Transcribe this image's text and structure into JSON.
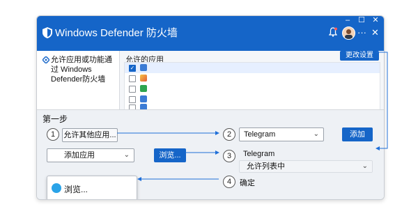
{
  "window": {
    "title": "Windows Defender 防火墙",
    "controls": {
      "minimize": "–",
      "maximize": "☐",
      "close": "✕"
    },
    "toolbar": {
      "more": "···",
      "close": "✕"
    }
  },
  "sidebar": {
    "items": [
      {
        "label": "允许应用或功能通过 Windows Defender防火墙",
        "icon": "shield-icon"
      }
    ]
  },
  "main": {
    "allowed_title": "允许的应用",
    "change_settings_label": "更改设置",
    "apps": [
      {
        "checked": true,
        "icon": "clipboard-icon",
        "color": "#3a7bd5"
      },
      {
        "checked": false,
        "icon": "photos-icon",
        "color": "#e35d3a"
      },
      {
        "checked": false,
        "icon": "calendar-icon",
        "color": "#2ea44f"
      },
      {
        "checked": false,
        "icon": "contacts-icon",
        "color": "#3a7bd5"
      },
      {
        "checked": false,
        "icon": "person-icon",
        "color": "#3a7bd5"
      }
    ]
  },
  "steps": {
    "title": "第一步",
    "step1": {
      "number": "1",
      "button_label": "允许其他应用..."
    },
    "step2": {
      "number": "2",
      "combo_value": "Telegram",
      "add_label": "添加"
    },
    "step3": {
      "number": "3",
      "app_name": "Telegram",
      "status_value": "允许列表中"
    },
    "step4": {
      "number": "4",
      "confirm_label": "确定"
    },
    "add_app_combo": "添加应用",
    "browse_button": "浏览...",
    "dropdown_item": "浏览..."
  },
  "colors": {
    "accent": "#1565c8",
    "titlebar": "#1565c8",
    "background": "#eef1f5"
  }
}
